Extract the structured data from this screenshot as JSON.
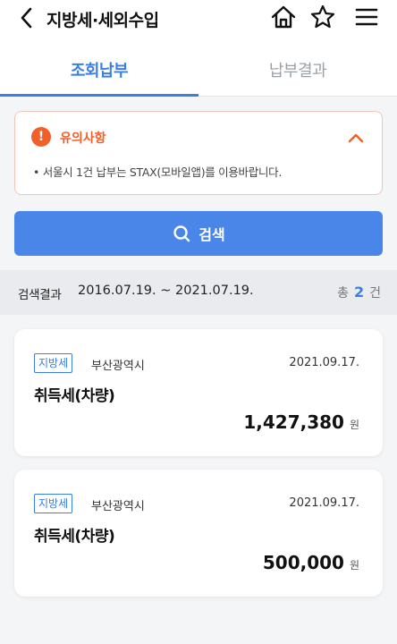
{
  "header": {
    "title": "지방세·세외수입"
  },
  "tabs": [
    {
      "label": "조회납부"
    },
    {
      "label": "납부결과"
    }
  ],
  "notice": {
    "title": "유의사항",
    "icon_text": "!",
    "text": "• 서울시 1건 납부는 STAX(모바일앱)를 이용바랍니다."
  },
  "search": {
    "label": "검색"
  },
  "results": {
    "label": "검색결과",
    "range": "2016.07.19. ~ 2021.07.19.",
    "count_prefix": "총",
    "count": "2",
    "count_suffix": "건"
  },
  "items": [
    {
      "tag": "지방세",
      "region": "부산광역시",
      "date": "2021.09.17.",
      "name": "취득세(차량)",
      "amount": "1,427,380",
      "unit": "원"
    },
    {
      "tag": "지방세",
      "region": "부산광역시",
      "date": "2021.09.17.",
      "name": "취득세(차량)",
      "amount": "500,000",
      "unit": "원"
    }
  ],
  "colors": {
    "accent": "#3a7ee6",
    "search_button": "#4a86e8",
    "notice": "#f25f2a"
  },
  "icons": [
    "back-icon",
    "home-icon",
    "star-icon",
    "menu-icon",
    "alert-icon",
    "chevron-up-icon",
    "search-icon"
  ]
}
